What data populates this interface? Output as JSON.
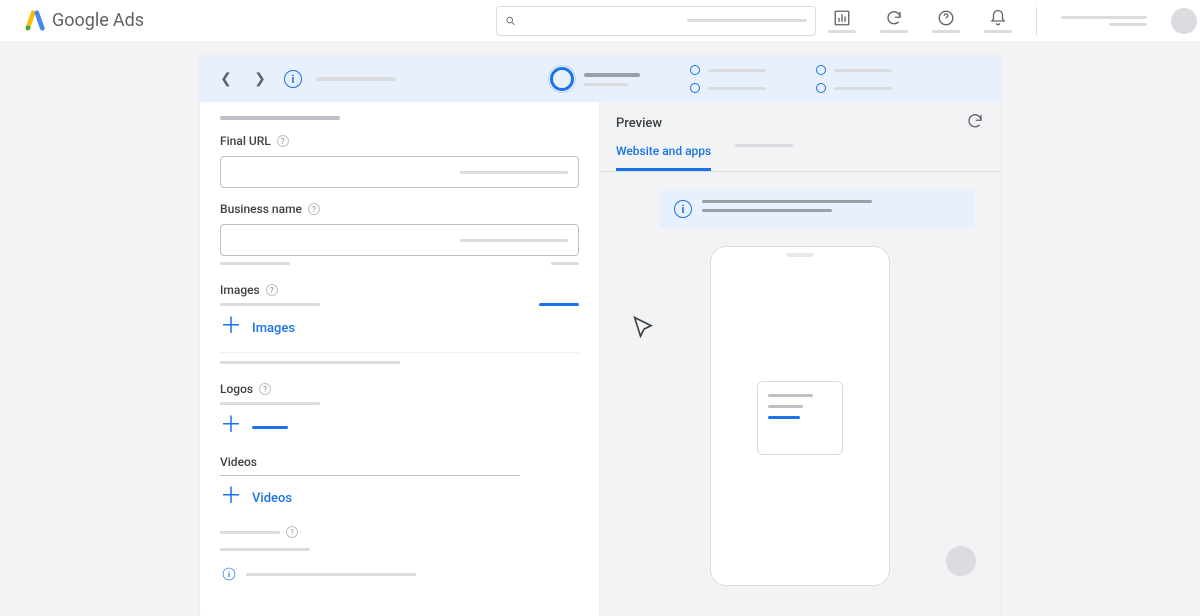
{
  "appbar": {
    "product_a": "Google",
    "product_b": "Ads",
    "search_placeholder": "",
    "icons": {
      "reports": "reports-icon",
      "refresh": "refresh-icon",
      "help": "help-icon",
      "notifications": "bell-icon"
    }
  },
  "stepper": {
    "breadcrumb": ""
  },
  "form": {
    "intro": "",
    "final_url": {
      "label": "Final URL",
      "value": ""
    },
    "business_name": {
      "label": "Business name",
      "value": ""
    },
    "images": {
      "label": "Images",
      "add_label": "Images"
    },
    "logos": {
      "label": "Logos",
      "add_label": ""
    },
    "videos": {
      "label": "Videos",
      "add_label": "Videos"
    }
  },
  "preview": {
    "title": "Preview",
    "tabs": {
      "active": "Website and apps",
      "other": ""
    }
  }
}
